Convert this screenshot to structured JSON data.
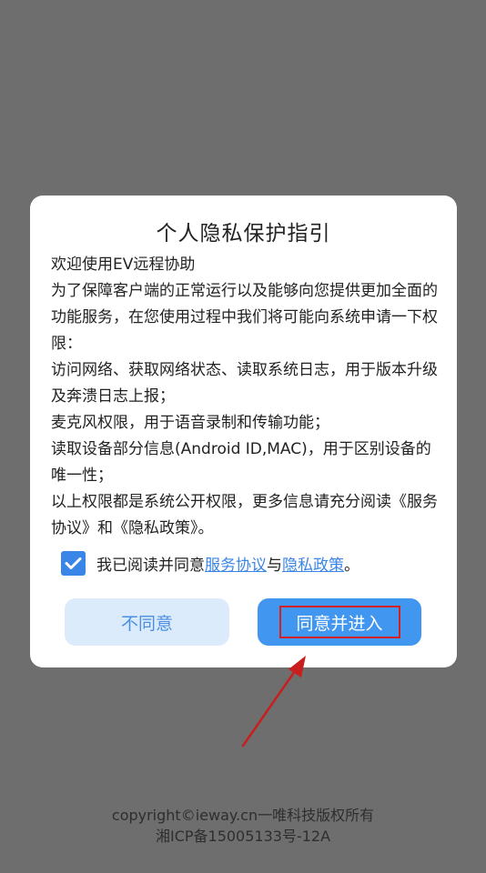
{
  "dialog": {
    "title": "个人隐私保护指引",
    "paragraphs": [
      "欢迎使用EV远程协助",
      " 为了保障客户端的正常运行以及能够向您提供更加全面的功能服务，在您使用过程中我们将可能向系统申请一下权限：",
      " 访问网络、获取网络状态、读取系统日志，用于版本升级及奔溃日志上报；",
      " 麦克风权限，用于语音录制和传输功能；",
      " 读取设备部分信息(Android ID,MAC)，用于区别设备的唯一性；",
      " 以上权限都是系统公开权限，更多信息请充分阅读《服务协议》和《隐私政策》。"
    ],
    "agree": {
      "checked": true,
      "prefix": "我已阅读并同意",
      "link1": "服务协议",
      "connector": "与",
      "link2": "隐私政策",
      "suffix": "。"
    },
    "buttons": {
      "disagree": "不同意",
      "agree": "同意并进入"
    }
  },
  "footer": {
    "line1": "copyright©ieway.cn一唯科技版权所有",
    "line2": "湘ICP备15005133号-12A"
  },
  "colors": {
    "accent": "#4196ef",
    "link": "#3a86e8",
    "annotation": "#d42020",
    "overlay": "#6e6e6e"
  }
}
